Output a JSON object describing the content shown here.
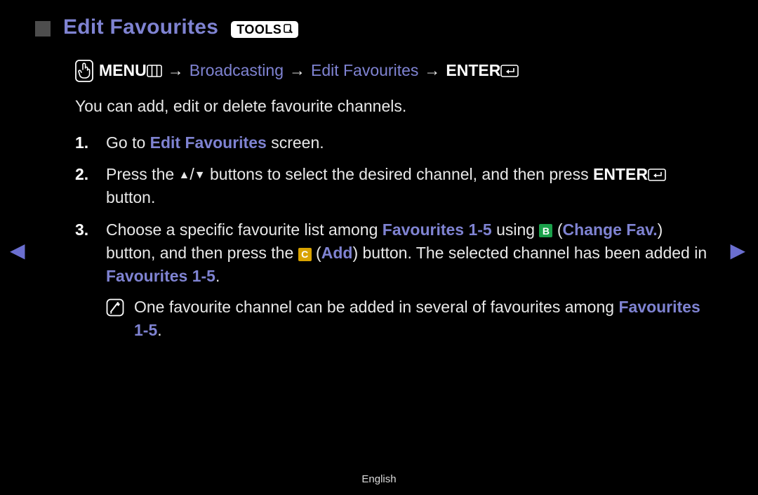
{
  "title": "Edit Favourites",
  "tools_label": "TOOLS",
  "path": {
    "menu": "MENU",
    "segments": [
      "Broadcasting",
      "Edit Favourites"
    ],
    "enter": "ENTER"
  },
  "intro": "You can add, edit or delete favourite channels.",
  "steps": {
    "s1": {
      "pre": "Go to ",
      "hl": "Edit Favourites",
      "post": " screen."
    },
    "s2": {
      "pre": "Press the ",
      "mid": " buttons to select the desired channel, and then press ",
      "enter": "ENTER",
      "post": " button."
    },
    "s3": {
      "pre": "Choose a specific favourite list among ",
      "fav": "Favourites 1-5",
      "using": " using ",
      "b_label": "B",
      "changefav": "Change Fav.",
      "mid1": " button, and then press the ",
      "c_label": "C",
      "add": "Add",
      "mid2": " button. The selected channel has been added in ",
      "fav2": "Favourites 1-5",
      "period": "."
    }
  },
  "note": {
    "pre": "One favourite channel can be added in several of favourites among ",
    "fav": "Favourites 1-5",
    "period": "."
  },
  "footer": "English",
  "nav": {
    "prev": "◀",
    "next": "▶"
  }
}
